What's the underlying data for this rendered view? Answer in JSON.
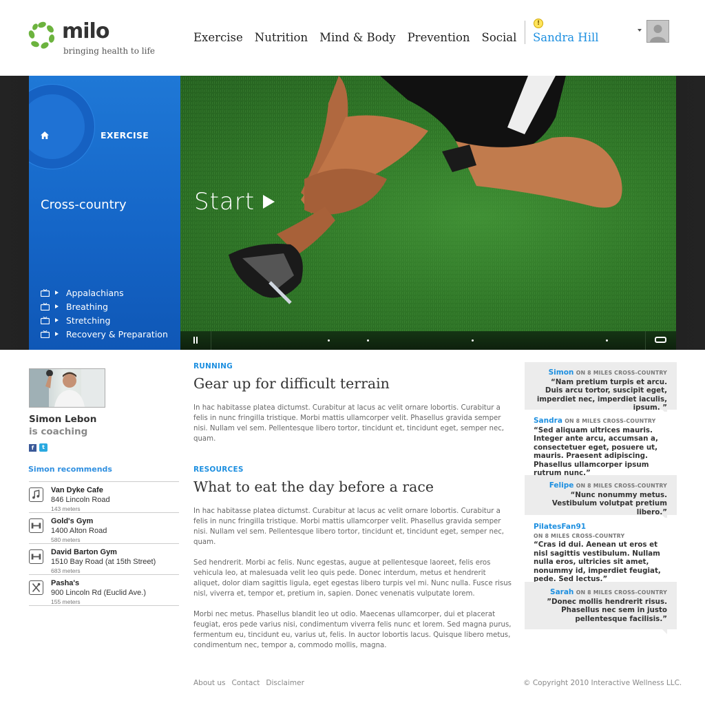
{
  "brand": {
    "name": "milo",
    "tagline": "bringing health to life",
    "logo_color": "#6cb33e"
  },
  "nav": {
    "items": [
      "Exercise",
      "Nutrition",
      "Mind & Body",
      "Prevention",
      "Social"
    ]
  },
  "user": {
    "name": "Sandra Hill",
    "alert_icon": "alert-icon",
    "alert_symbol": "!"
  },
  "hero": {
    "section": "EXERCISE",
    "title": "Cross-country",
    "topics": [
      "Appalachians",
      "Breathing",
      "Stretching",
      "Recovery & Preparation"
    ],
    "start_label": "Start",
    "accent": "#1566c8",
    "progress_markers": [
      0.27,
      0.36,
      0.6,
      0.91
    ]
  },
  "coach": {
    "name": "Simon Lebon",
    "status": "is coaching",
    "facebook_glyph": "f",
    "twitter_glyph": "t",
    "recommends_title": "Simon recommends",
    "places": [
      {
        "name": "Van Dyke Cafe",
        "address": "846 Lincoln Road",
        "distance": "143 meters",
        "icon": "music-icon"
      },
      {
        "name": "Gold's Gym",
        "address": "1400 Alton Road",
        "distance": "580 meters",
        "icon": "dumbbell-icon"
      },
      {
        "name": "David Barton Gym",
        "address": "1510 Bay Road (at 15th Street)",
        "distance": "683 meters",
        "icon": "dumbbell-icon"
      },
      {
        "name": "Pasha's",
        "address": "900 Lincoln Rd (Euclid Ave.)",
        "distance": "155 meters",
        "icon": "utensils-icon"
      }
    ]
  },
  "articles": [
    {
      "category": "RUNNING",
      "title": "Gear up for difficult terrain",
      "paragraphs": [
        "In hac habitasse platea dictumst. Curabitur at lacus ac velit ornare lobortis. Curabitur a felis in nunc fringilla tristique. Morbi mattis ullamcorper velit. Phasellus gravida semper nisi. Nullam vel sem. Pellentesque libero tortor, tincidunt et, tincidunt eget, semper nec, quam."
      ]
    },
    {
      "category": "RESOURCES",
      "title": "What to eat the day before a race",
      "paragraphs": [
        "In hac habitasse platea dictumst. Curabitur at lacus ac velit ornare lobortis. Curabitur a felis in nunc fringilla tristique. Morbi mattis ullamcorper velit. Phasellus gravida semper nisi. Nullam vel sem. Pellentesque libero tortor, tincidunt et, tincidunt eget, semper nec, quam.",
        "Sed hendrerit. Morbi ac felis. Nunc egestas, augue at pellentesque laoreet, felis eros vehicula leo, at malesuada velit leo quis pede. Donec interdum, metus et hendrerit aliquet, dolor diam sagittis ligula, eget egestas libero turpis vel mi. Nunc nulla. Fusce risus nisl, viverra et, tempor et, pretium in, sapien. Donec venenatis vulputate lorem.",
        "Morbi nec metus. Phasellus blandit leo ut odio. Maecenas ullamcorper, dui et placerat feugiat, eros pede varius nisi, condimentum viverra felis nunc et lorem. Sed magna purus, fermentum eu, tincidunt eu, varius ut, felis. In auctor lobortis lacus. Quisque libero metus, condimentum nec, tempor a, commodo mollis, magna."
      ]
    }
  ],
  "comments": [
    {
      "user": "Simon",
      "context": "ON 8 MILES CROSS-COUNTRY",
      "text": "“Nam pretium turpis et arcu. Duis arcu tortor, suscipit eget, imperdiet nec, imperdiet iaculis, ipsum. ”"
    },
    {
      "user": "Sandra",
      "context": "ON 8 MILES CROSS-COUNTRY",
      "text": "“Sed aliquam ultrices mauris. Integer ante arcu, accumsan a, consectetuer eget, posuere ut, mauris. Praesent adipiscing. Phasellus ullamcorper ipsum rutrum nunc.”"
    },
    {
      "user": "Felipe",
      "context": "ON 8 MILES CROSS-COUNTRY",
      "text": "“Nunc nonummy metus. Vestibulum volutpat pretium libero.”"
    },
    {
      "user": "PilatesFan91",
      "context": "ON 8 MILES CROSS-COUNTRY",
      "text": "“Cras id dui. Aenean ut eros et nisl sagittis vestibulum. Nullam nulla eros, ultricies sit amet, nonummy id, imperdiet feugiat, pede. Sed lectus.”"
    },
    {
      "user": "Sarah",
      "context": "ON 8 MILES CROSS-COUNTRY",
      "text": "”Donec mollis hendrerit risus. Phasellus nec sem in justo pellentesque facilisis.”"
    }
  ],
  "footer": {
    "links": [
      "About us",
      "Contact",
      "Disclaimer"
    ],
    "copyright": "© Copyright 2010 Interactive Wellness LLC."
  }
}
